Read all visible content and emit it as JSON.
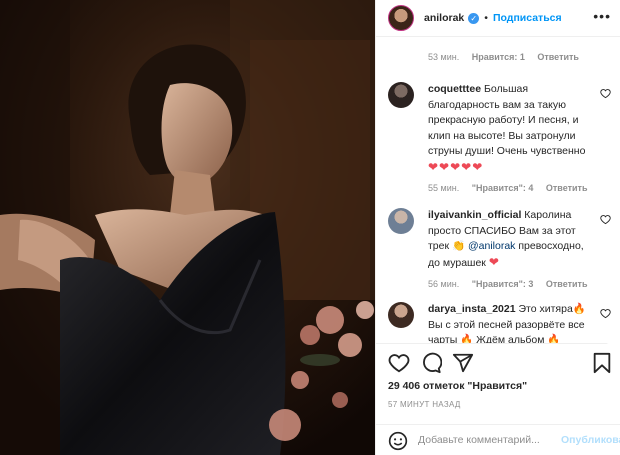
{
  "header": {
    "username": "anilorak",
    "separator": "•",
    "follow_label": "Подписаться",
    "more_label": "•••"
  },
  "first_meta": {
    "time": "53 мин.",
    "likes": "Нравится: 1",
    "reply": "Ответить"
  },
  "comments": [
    {
      "username": "coquetttee",
      "text": "Большая благодарность вам за такую прекрасную работу! И песня, и клип на высоте! Вы затронули струны души! Очень чувственно",
      "hearts": "❤❤❤❤❤",
      "time": "55 мин.",
      "likes": "\"Нравится\": 4",
      "reply": "Ответить"
    },
    {
      "username": "ilyaivankin_official",
      "text_before": "Каролина просто СПАСИБО Вам за этот трек 👏",
      "mention": "@anilorak",
      "text_after": "превосходно, до мурашек",
      "heart": "❤",
      "time": "56 мин.",
      "likes": "\"Нравится\": 3",
      "reply": "Ответить"
    },
    {
      "username": "darya_insta_2021",
      "text": "Это хитяра🔥 Вы с этой песней разорвёте все",
      "text_cut": "чарты 🔥 Ждём альбом 🔥"
    }
  ],
  "actions": {
    "likes_count": "29 406 отметок \"Нравится\"",
    "timestamp": "57 МИНУТ НАЗАД",
    "comment_placeholder": "Добавьте комментарий...",
    "publish_label": "Опубликовать"
  },
  "colors": {
    "accent_blue": "#0095f6",
    "heart_red": "#ed4956",
    "muted": "#8e8e8e",
    "verified_blue": "#3897f0"
  },
  "icons": [
    "verified-badge-icon",
    "more-icon",
    "heart-icon",
    "comment-icon",
    "share-icon",
    "bookmark-icon",
    "emoji-icon"
  ]
}
